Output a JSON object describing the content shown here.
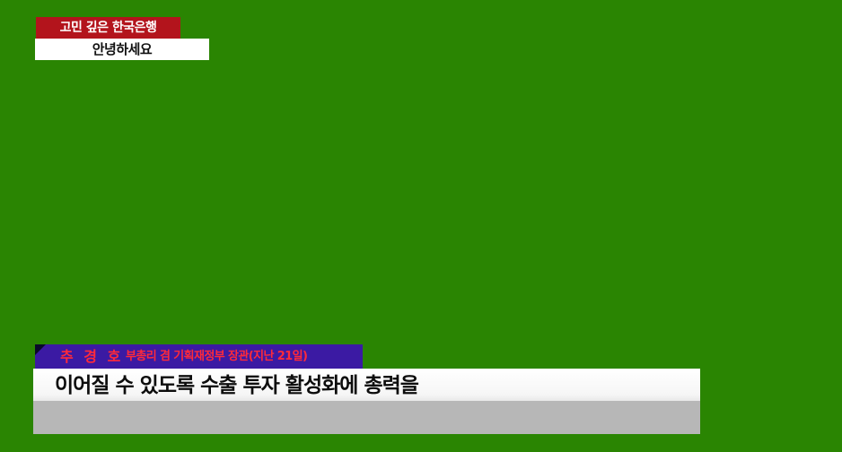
{
  "top_caption": {
    "tag": "고민 깊은 한국은행",
    "subtitle": "안녕하세요"
  },
  "lower_third": {
    "speaker_name": "추 경 호",
    "speaker_title": "부총리 겸 기획재정부 장관(지난 21일)",
    "headline": "이어질 수 있도록 수출 투자 활성화에 총력을",
    "subline": ""
  },
  "colors": {
    "background": "#2a8502",
    "tag_red": "#b3141c",
    "speaker_bar_purple": "#3b1aa3",
    "speaker_text_red": "#ff2a3a",
    "sub_bar_gray": "#b7b7b7"
  }
}
